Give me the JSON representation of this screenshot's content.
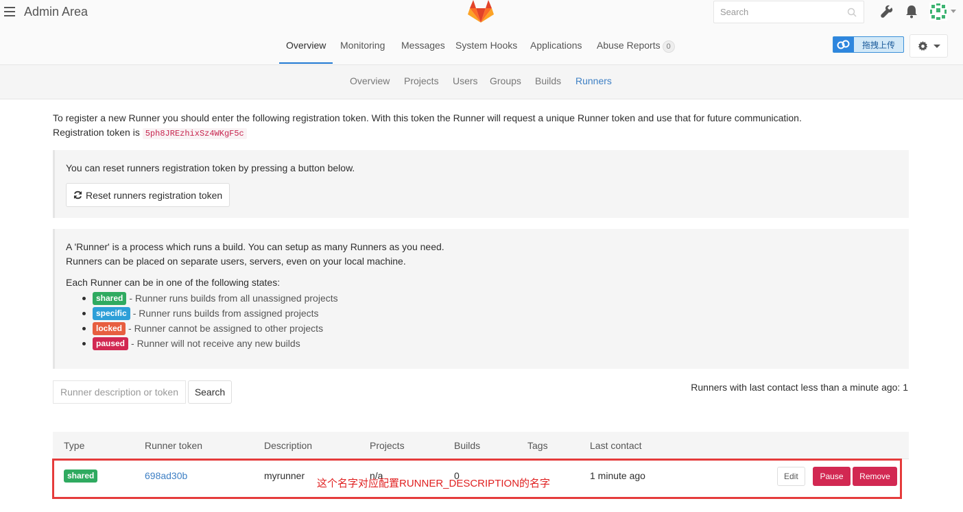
{
  "header": {
    "title": "Admin Area",
    "search_placeholder": "Search",
    "upload_label": "拖拽上传"
  },
  "nav": {
    "tabs": [
      {
        "label": "Overview",
        "active": true
      },
      {
        "label": "Monitoring"
      },
      {
        "label": "Messages"
      },
      {
        "label": "System Hooks"
      },
      {
        "label": "Applications"
      },
      {
        "label": "Abuse Reports",
        "count": "0"
      }
    ]
  },
  "subnav": {
    "items": [
      {
        "label": "Overview"
      },
      {
        "label": "Projects"
      },
      {
        "label": "Users"
      },
      {
        "label": "Groups"
      },
      {
        "label": "Builds"
      },
      {
        "label": "Runners",
        "active": true
      }
    ]
  },
  "intro": {
    "line1": "To register a new Runner you should enter the following registration token. With this token the Runner will request a unique Runner token and use that for future communication.",
    "token_prefix": "Registration token is",
    "token": "5ph8JREzhixSz4WKgF5c"
  },
  "reset": {
    "text": "You can reset runners registration token by pressing a button below.",
    "button_label": "Reset runners registration token"
  },
  "info": {
    "line1": "A 'Runner' is a process which runs a build. You can setup as many Runners as you need.",
    "line2": "Runners can be placed on separate users, servers, even on your local machine.",
    "states_heading": "Each Runner can be in one of the following states:",
    "states": [
      {
        "badge": "shared",
        "text": "- Runner runs builds from all unassigned projects",
        "color": "#2faa60"
      },
      {
        "badge": "specific",
        "text": "- Runner runs builds from assigned projects",
        "color": "#2d9fd8"
      },
      {
        "badge": "locked",
        "text": "- Runner cannot be assigned to other projects",
        "color": "#e75e40"
      },
      {
        "badge": "paused",
        "text": "- Runner will not receive any new builds",
        "color": "#d22852"
      }
    ]
  },
  "filter": {
    "placeholder": "Runner description or token",
    "search_label": "Search",
    "summary": "Runners with last contact less than a minute ago: 1"
  },
  "table": {
    "headers": [
      "Type",
      "Runner token",
      "Description",
      "Projects",
      "Builds",
      "Tags",
      "Last contact"
    ],
    "rows": [
      {
        "type": "shared",
        "token": "698ad30b",
        "description": "myrunner",
        "projects": "n/a",
        "builds": "0",
        "tags": "",
        "last_contact": "1 minute ago",
        "edit_label": "Edit",
        "pause_label": "Pause",
        "remove_label": "Remove"
      }
    ]
  },
  "annotation": "这个名字对应配置RUNNER_DESCRIPTION的名字",
  "colors": {
    "accent": "#1f78d1",
    "link": "#3d7fc4",
    "danger": "#d22852",
    "annotation_red": "#e53b3b"
  }
}
